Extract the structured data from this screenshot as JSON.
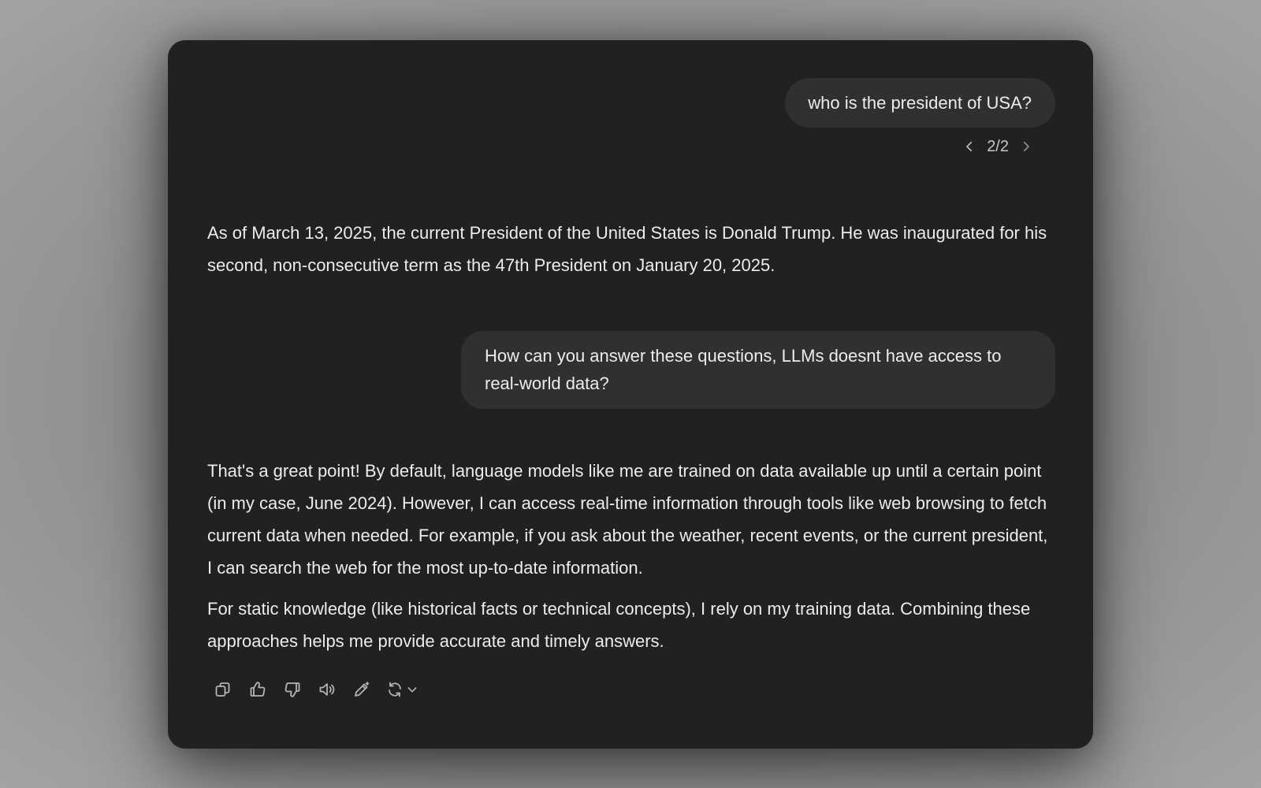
{
  "conversation": {
    "user_message_1": "who is the president of USA?",
    "pager": {
      "label": "2/2",
      "prev_icon": "chevron-left-icon",
      "next_icon": "chevron-right-icon"
    },
    "assistant_message_1": "As of March 13, 2025, the current President of the United States is Donald Trump. He was inaugurated for his second, non-consecutive term as the 47th President on January 20, 2025.",
    "user_message_2": "How can you answer these questions, LLMs doesnt have access to real-world data?",
    "assistant_message_2": {
      "paragraph_1": "That's a great point! By default, language models like me are trained on data available up until a certain point (in my case, June 2024). However, I can access real-time information through tools like web browsing to fetch current data when needed. For example, if you ask about the weather, recent events, or the current president, I can search the web for the most up-to-date information.",
      "paragraph_2": "For static knowledge (like historical facts or technical concepts), I rely on my training data. Combining these approaches helps me provide accurate and timely answers."
    },
    "actions": [
      "copy-icon",
      "thumbs-up-icon",
      "thumbs-down-icon",
      "speaker-icon",
      "edit-icon",
      "regenerate-icon",
      "chevron-down-icon"
    ]
  },
  "colors": {
    "window_bg": "#212121",
    "bubble_bg": "#303030",
    "text": "#ececec",
    "muted": "#b4b4b4"
  }
}
